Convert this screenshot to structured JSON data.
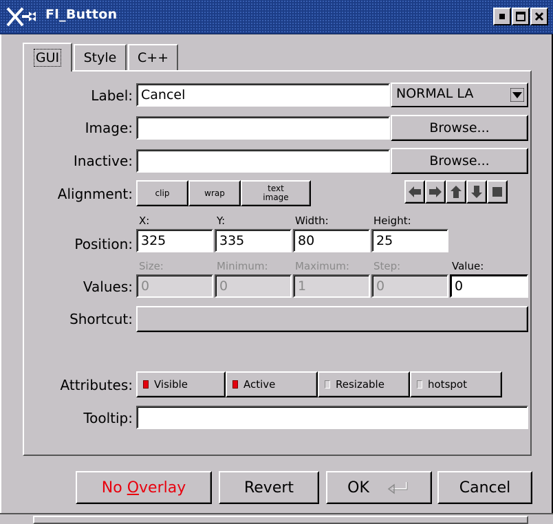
{
  "window": {
    "title": "Fl_Button",
    "icon": "fltk-logo-icon",
    "buttons": [
      "minimize-icon",
      "maximize-icon",
      "close-icon"
    ]
  },
  "tabs": [
    {
      "label": "GUI",
      "active": true
    },
    {
      "label": "Style",
      "active": false
    },
    {
      "label": "C++",
      "active": false
    }
  ],
  "gui": {
    "label": {
      "caption": "Label:",
      "value": "Cancel",
      "type": "NORMAL_LABEL",
      "type_display": "NORMAL  LA"
    },
    "image": {
      "caption": "Image:",
      "value": "",
      "browse": "Browse..."
    },
    "inactive": {
      "caption": "Inactive:",
      "value": "",
      "browse": "Browse..."
    },
    "alignment": {
      "caption": "Alignment:",
      "buttons": [
        "clip",
        "wrap"
      ],
      "text_image": [
        "text",
        "image"
      ],
      "arrows": [
        "left-arrow-icon",
        "right-arrow-icon",
        "up-arrow-icon",
        "down-arrow-icon",
        "square-icon"
      ]
    },
    "position": {
      "caption": "Position:",
      "fields": [
        {
          "label": "X:",
          "value": "325"
        },
        {
          "label": "Y:",
          "value": "335"
        },
        {
          "label": "Width:",
          "value": "80"
        },
        {
          "label": "Height:",
          "value": "25"
        }
      ]
    },
    "values": {
      "caption": "Values:",
      "fields": [
        {
          "label": "Size:",
          "value": "0",
          "enabled": false
        },
        {
          "label": "Minimum:",
          "value": "0",
          "enabled": false
        },
        {
          "label": "Maximum:",
          "value": "1",
          "enabled": false
        },
        {
          "label": "Step:",
          "value": "0",
          "enabled": false
        },
        {
          "label": "Value:",
          "value": "0",
          "enabled": true
        }
      ]
    },
    "shortcut": {
      "caption": "Shortcut:",
      "value": ""
    },
    "attributes": {
      "caption": "Attributes:",
      "items": [
        {
          "label": "Visible",
          "checked": true
        },
        {
          "label": "Active",
          "checked": true
        },
        {
          "label": "Resizable",
          "checked": false
        },
        {
          "label": "hotspot",
          "checked": false
        }
      ]
    },
    "tooltip": {
      "caption": "Tooltip:",
      "value": ""
    }
  },
  "footer": {
    "no_overlay": {
      "prefix": "No ",
      "underline": "O",
      "suffix": "verlay",
      "color": "#e8000e"
    },
    "revert": "Revert",
    "ok": "OK",
    "ok_icon": "return-key-icon",
    "cancel": "Cancel"
  },
  "colors": {
    "titlebar": "#1c3d87",
    "window_bg": "#c7c3c7",
    "led_on": "#e3000f"
  }
}
